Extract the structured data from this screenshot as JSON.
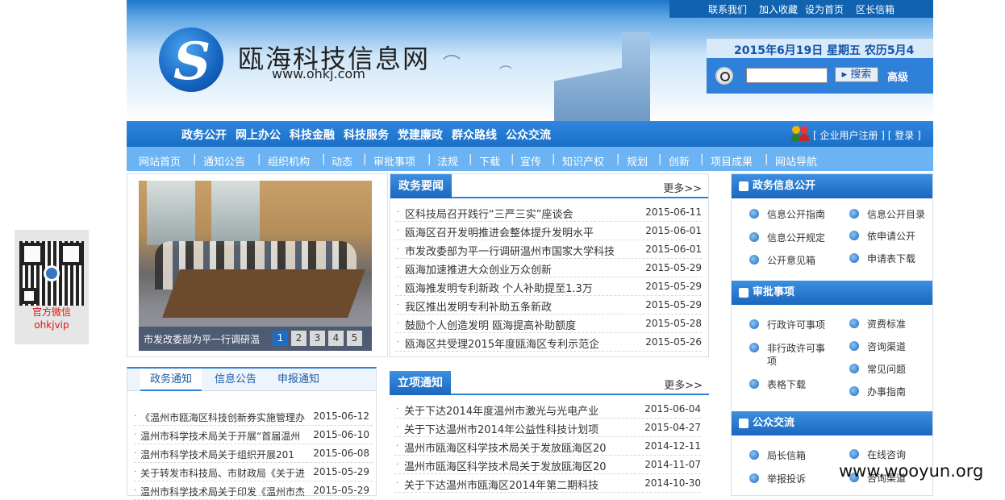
{
  "qr": {
    "line1": "官方微信",
    "line2": "ohkjvip"
  },
  "topbar": {
    "links": [
      "联系我们",
      "加入收藏",
      "设为首页",
      "区长信箱"
    ]
  },
  "header": {
    "site_name": "瓯海科技信息网",
    "site_url": "www.ohkj.com",
    "date": "2015年6月19日 星期五 农历5月4",
    "search_button": "搜索",
    "advanced": "高级"
  },
  "mainnav": {
    "items": [
      "政务公开",
      "网上办公",
      "科技金融",
      "科技服务",
      "党建廉政",
      "群众路线",
      "公众交流"
    ],
    "user_links": "[ 企业用户注册 ] [ 登录 ]"
  },
  "subnav": {
    "items": [
      "网站首页",
      "通知公告",
      "组织机构",
      "动态",
      "审批事项",
      "法规",
      "下载",
      "宣传",
      "知识产权",
      "规划",
      "创新",
      "项目成果",
      "网站导航"
    ]
  },
  "slideshow": {
    "caption": "市发改委部为平一行调研温",
    "pages": [
      "1",
      "2",
      "3",
      "4",
      "5"
    ],
    "active_page": "1"
  },
  "news": {
    "title": "政务要闻",
    "more": "更多>>",
    "rows": [
      {
        "title": "区科技局召开践行“三严三实”座谈会",
        "date": "2015-06-11"
      },
      {
        "title": "瓯海区召开发明推进会整体提升发明水平",
        "date": "2015-06-01"
      },
      {
        "title": "市发改委部为平一行调研温州市国家大学科技",
        "date": "2015-06-01"
      },
      {
        "title": "瓯海加速推进大众创业万众创新",
        "date": "2015-05-29"
      },
      {
        "title": "瓯海推发明专利新政 个人补助提至1.3万",
        "date": "2015-05-29"
      },
      {
        "title": "我区推出发明专利补助五条新政",
        "date": "2015-05-29"
      },
      {
        "title": "鼓励个人创造发明 瓯海提高补助额度",
        "date": "2015-05-28"
      },
      {
        "title": "瓯海区共受理2015年度瓯海区专利示范企",
        "date": "2015-05-26"
      }
    ]
  },
  "projects": {
    "title": "立项通知",
    "more": "更多>>",
    "rows": [
      {
        "title": "关于下达2014年度温州市激光与光电产业",
        "date": "2015-06-04"
      },
      {
        "title": "关于下达温州市2014年公益性科技计划项",
        "date": "2015-04-27"
      },
      {
        "title": "温州市瓯海区科学技术局关于发放瓯海区20",
        "date": "2014-12-11"
      },
      {
        "title": "温州市瓯海区科学技术局关于发放瓯海区20",
        "date": "2014-11-07"
      },
      {
        "title": "关于下达温州市瓯海区2014年第二期科技",
        "date": "2014-10-30"
      }
    ]
  },
  "notices": {
    "tabs": [
      "政务通知",
      "信息公告",
      "申报通知"
    ],
    "active_tab": "政务通知",
    "rows": [
      {
        "title": "《温州市瓯海区科技创新券实施管理办",
        "date": "2015-06-12"
      },
      {
        "title": "温州市科学技术局关于开展“首届温州",
        "date": "2015-06-10"
      },
      {
        "title": "温州市科学技术局关于组织开展201",
        "date": "2015-06-08"
      },
      {
        "title": "关于转发市科技局、市财政局《关于进",
        "date": "2015-05-29"
      },
      {
        "title": "温州市科学技术局关于印发《温州市杰",
        "date": "2015-05-29"
      }
    ]
  },
  "right": {
    "sections": [
      {
        "title": "政务信息公开",
        "items": [
          "信息公开指南",
          "信息公开目录",
          "信息公开规定",
          "依申请公开",
          "公开意见箱",
          "申请表下载"
        ]
      },
      {
        "title": "审批事项",
        "items": [
          "行政许可事项",
          "资费标准",
          "非行政许可事项",
          "咨询渠道",
          "常见问题",
          "表格下载",
          "办事指南"
        ]
      },
      {
        "title": "公众交流",
        "items": [
          "局长信箱",
          "在线咨询",
          "举报投诉",
          "咨询渠道"
        ]
      }
    ]
  },
  "watermark": "www.wooyun.org"
}
